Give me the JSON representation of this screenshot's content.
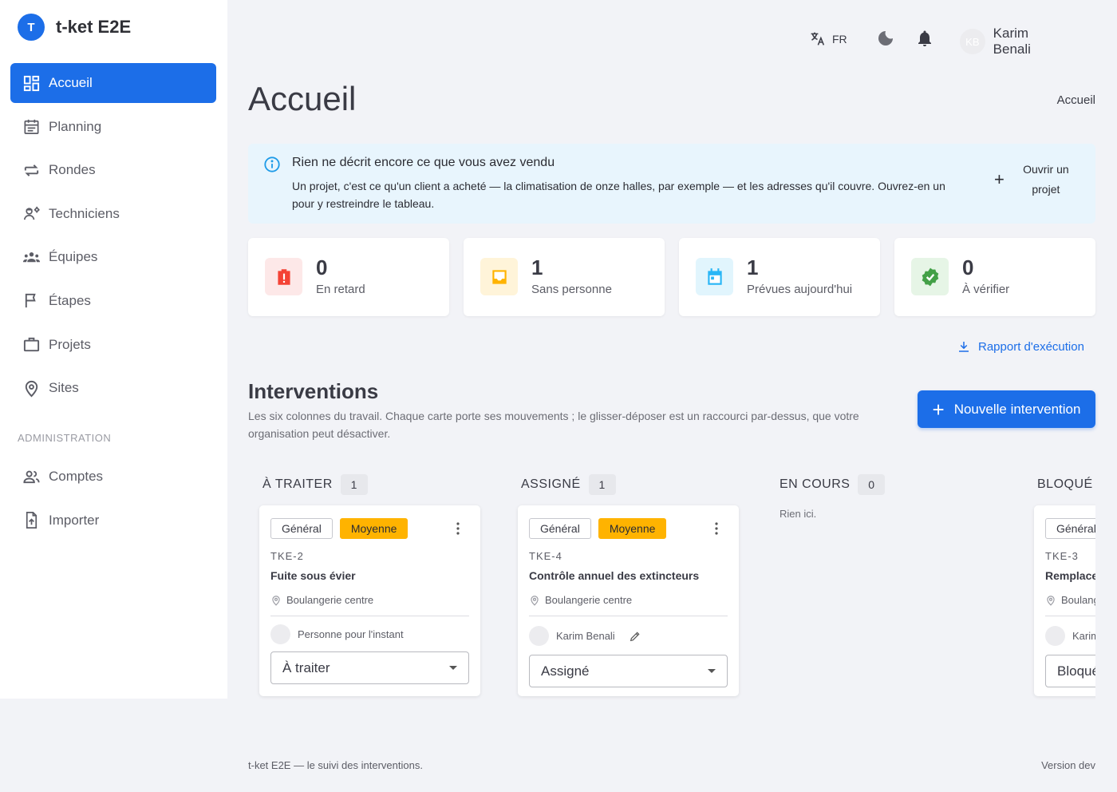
{
  "app": {
    "logo_letter": "T",
    "name": "t-ket E2E"
  },
  "sidebar": {
    "items": [
      {
        "label": "Accueil",
        "icon": "dashboard-icon",
        "active": true
      },
      {
        "label": "Planning",
        "icon": "calendar-icon"
      },
      {
        "label": "Rondes",
        "icon": "repeat-icon"
      },
      {
        "label": "Techniciens",
        "icon": "engineer-icon"
      },
      {
        "label": "Équipes",
        "icon": "groups-icon"
      },
      {
        "label": "Étapes",
        "icon": "flag-icon"
      },
      {
        "label": "Projets",
        "icon": "briefcase-icon"
      },
      {
        "label": "Sites",
        "icon": "location-pin-icon"
      }
    ],
    "admin_section": "ADMINISTRATION",
    "admin_items": [
      {
        "label": "Comptes",
        "icon": "people-icon"
      },
      {
        "label": "Importer",
        "icon": "file-upload-icon"
      }
    ]
  },
  "topbar": {
    "lang": "FR",
    "user_initials": "KB",
    "user_name": "Karim Benali"
  },
  "page": {
    "title": "Accueil",
    "breadcrumb": "Accueil"
  },
  "banner": {
    "title": "Rien ne décrit encore ce que vous avez vendu",
    "text": "Un projet, c'est ce qu'un client a acheté — la climatisation de onze halles, par exemple — et les adresses qu'il couvre. Ouvrez-en un pour y restreindre le tableau.",
    "action_label": "Ouvrir un projet"
  },
  "stats": [
    {
      "value": "0",
      "label": "En retard",
      "color": "#f44336",
      "bg": "#fde8e8",
      "icon": "alert-icon"
    },
    {
      "value": "1",
      "label": "Sans personne",
      "color": "#ffb300",
      "bg": "#fff4d9",
      "icon": "inbox-icon"
    },
    {
      "value": "1",
      "label": "Prévues aujourd'hui",
      "color": "#29b6f6",
      "bg": "#e1f5fd",
      "icon": "calendar-today-icon"
    },
    {
      "value": "0",
      "label": "À vérifier",
      "color": "#43a047",
      "bg": "#e6f5e6",
      "icon": "verified-icon"
    }
  ],
  "report_link": "Rapport d'exécution",
  "interventions": {
    "title": "Interventions",
    "description": "Les six colonnes du travail. Chaque carte porte ses mouvements ; le glisser-déposer est un raccourci par-dessus, que votre organisation peut désactiver.",
    "new_button": "Nouvelle intervention"
  },
  "columns": [
    {
      "title": "À TRAITER",
      "count": "1",
      "card": {
        "tag1": "Général",
        "tag2": "Moyenne",
        "id": "TKE-2",
        "title": "Fuite sous évier",
        "site": "Boulangerie centre",
        "assignee": "Personne pour l'instant",
        "status": "À traiter"
      }
    },
    {
      "title": "ASSIGNÉ",
      "count": "1",
      "card": {
        "tag1": "Général",
        "tag2": "Moyenne",
        "id": "TKE-4",
        "title": "Contrôle annuel des extincteurs",
        "site": "Boulangerie centre",
        "assignee": "Karim Benali",
        "status": "Assigné"
      }
    },
    {
      "title": "EN COURS",
      "count": "0",
      "empty": "Rien ici."
    },
    {
      "title": "BLOQUÉ",
      "card": {
        "tag1": "Général",
        "id": "TKE-3",
        "title": "Remplacement",
        "site": "Boulangerie",
        "assignee": "Karim",
        "status": "Bloqué"
      }
    }
  ],
  "footer": {
    "left": "t-ket E2E — le suivi des interventions.",
    "right": "Version dev"
  }
}
